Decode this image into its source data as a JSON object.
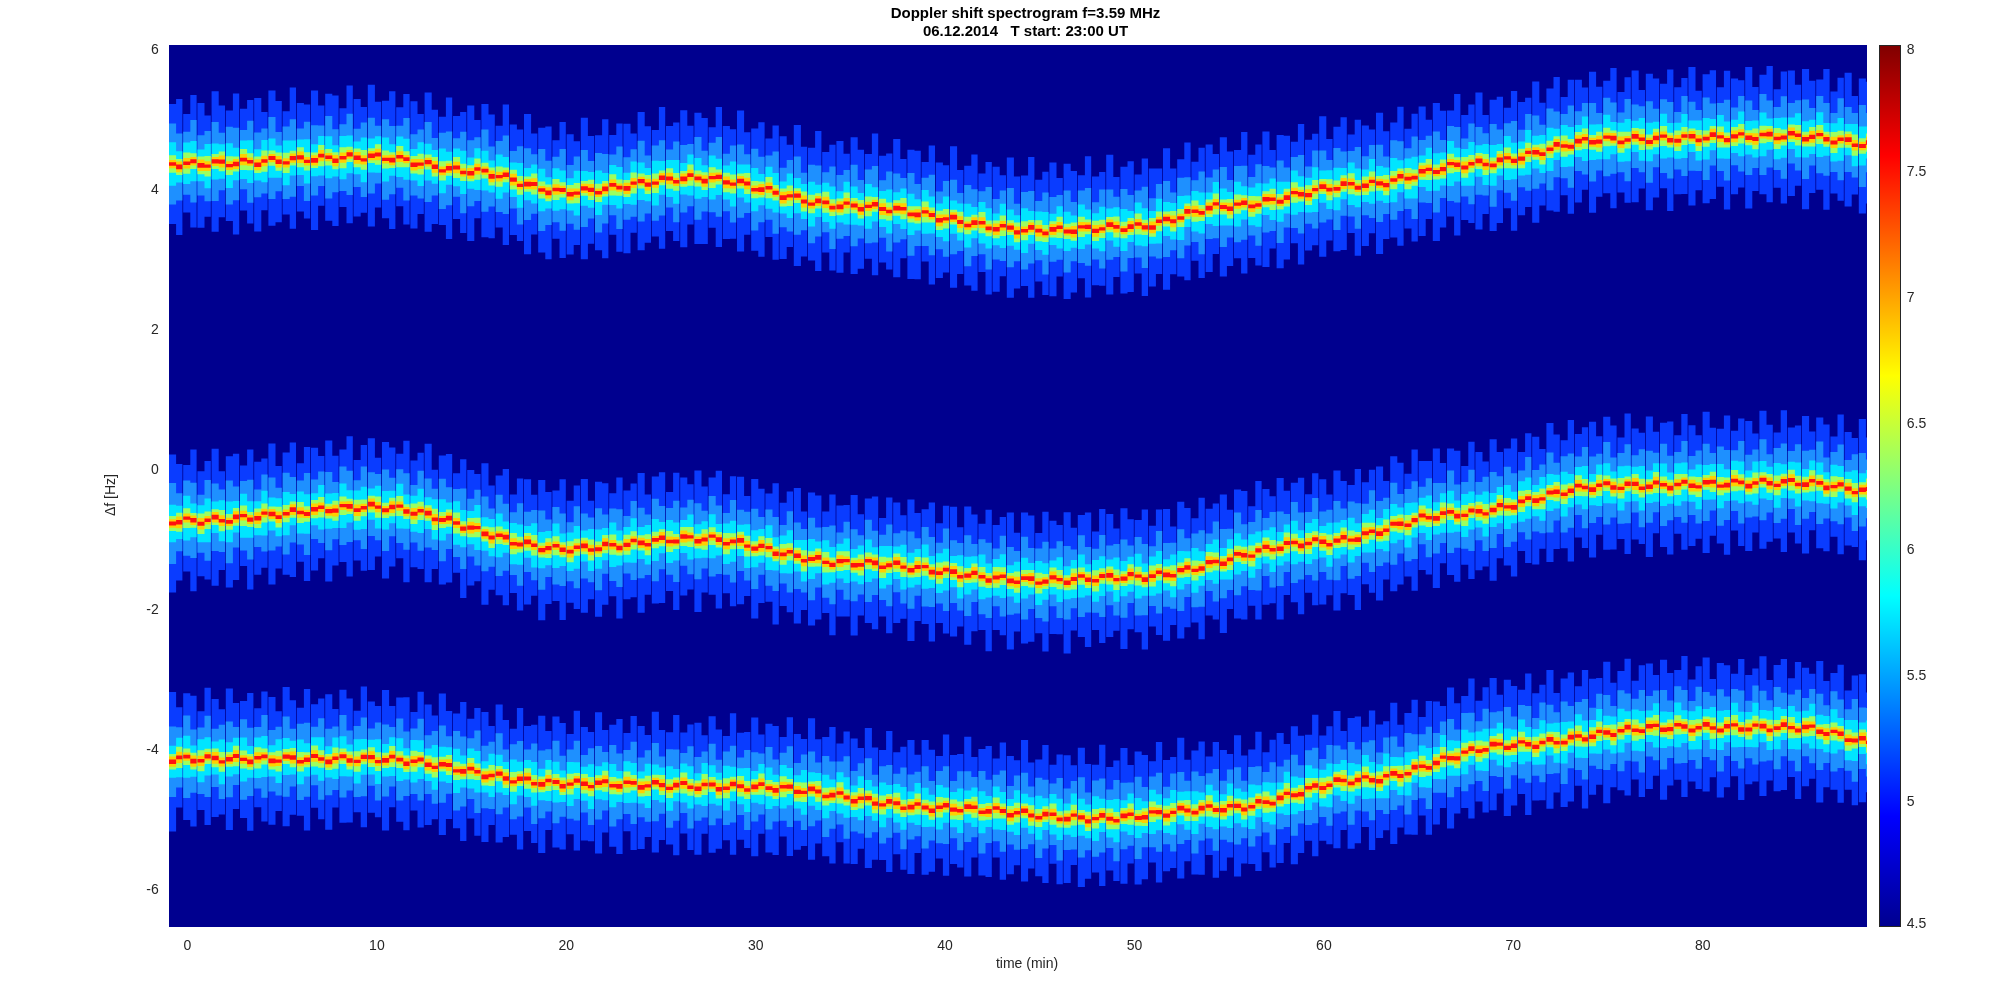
{
  "figure": {
    "title_lines": [
      "Doppler shift spectrogram f=3.59 MHz",
      "06.12.2014   T start: 23:00 UT"
    ],
    "y_axis": {
      "label": "Δf [Hz]",
      "ticks": [
        "6",
        "4",
        "2",
        "0",
        "-2",
        "-4",
        "-6"
      ]
    },
    "x_axis": {
      "label": "time (min)",
      "ticks": [
        "0",
        "10",
        "20",
        "30",
        "40",
        "50",
        "60",
        "70",
        "80"
      ]
    },
    "colorbar": {
      "ticks": [
        "8",
        "7.5",
        "7",
        "6.5",
        "6",
        "5.5",
        "5",
        "4.5"
      ]
    }
  }
}
